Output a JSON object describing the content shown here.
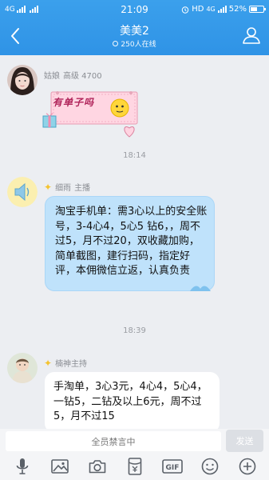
{
  "status_bar": {
    "left_network": "4G",
    "time": "21:09",
    "right_hd": "HD",
    "right_network": "4G",
    "battery": "52%"
  },
  "header": {
    "title": "美美2",
    "online": "250人在线"
  },
  "messages": [
    {
      "sender": "姑娘",
      "title_tag": "高级 4700",
      "sticker_text": "有单子吗"
    },
    {
      "sender": "细雨",
      "title_tag": "主播",
      "text": "淘宝手机单：需3心以上的安全账号，3-4心4，5心5 钻6，，周不过5，月不过20，双收藏加购，简单截图，建行扫码，指定好评，本佣微信立返，认真负责"
    },
    {
      "sender": "楠神主持",
      "title_tag": "",
      "text": "手淘单，3心3元，4心4，5心4，一钻5，二钻及以上6元，周不过5，月不过15"
    }
  ],
  "timestamps": [
    "18:14",
    "18:39"
  ],
  "input": {
    "muted_text": "全员禁言中",
    "send_label": "发送"
  },
  "toolbar": [
    "voice-icon",
    "image-icon",
    "camera-icon",
    "red-packet-icon",
    "gif-icon",
    "emoji-icon",
    "plus-icon"
  ],
  "colors": {
    "header_blue": "#3399e6",
    "bubble_blue": "#bfe2fb",
    "background": "#eceef2"
  }
}
